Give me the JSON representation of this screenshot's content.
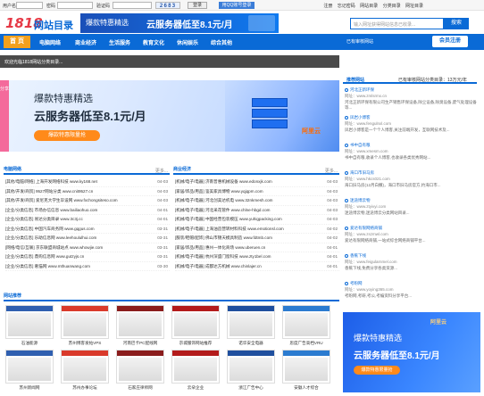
{
  "topbar": {
    "user_label": "用户名",
    "pass_label": "密码",
    "code_label": "验证码",
    "captcha": "2683",
    "login_btn": "登录",
    "qq_login": "用QQ账号登录",
    "links": [
      "注册",
      "忘记密码",
      "网站目录",
      "分类目录",
      "网址目录"
    ]
  },
  "header": {
    "logo_num": "1818",
    "logo_text": "网站目录",
    "banner_a": "爆款特惠精选",
    "banner_b": "云服务器低至8.1元/月",
    "search_placeholder": "输入网址获得网站信息已收录...",
    "search_btn": "搜索"
  },
  "nav": {
    "home": "首 页",
    "items": [
      "电脑网络",
      "商业经济",
      "生活服务",
      "教育文化",
      "休闲娱乐",
      "综合其他"
    ],
    "ad_text": "已有审核网站",
    "register": "会员注册"
  },
  "notice": "欢迎光临1818网站分类目录...",
  "left_ad_tag": "分享",
  "hero": {
    "line1": "爆款特惠精选",
    "line2": "云服务器低至8.1元/月",
    "button": "爆款特惠限量抢",
    "brand": "阿里云"
  },
  "news": {
    "left_title": "电脑网络",
    "right_title": "商业经济",
    "more": "更多...",
    "left_rows": [
      {
        "text": "[其他/电脑/网络] 上海开发网络科技 www.ky168.net",
        "date": "04-03"
      },
      {
        "text": "[其他/开发/商贸] 9527网站分类 www.cnit9527.cn",
        "date": "04-03"
      },
      {
        "text": "[其他/开发/商贸] 爱尼克大学生毕设网 www.fxchongsiteso.com",
        "date": "04-03"
      },
      {
        "text": "[企业/分类信息] 市场办信信息 www.bailiaohuo.com",
        "date": "04-01"
      },
      {
        "text": "[企业/分类信息] 易达分类目录 www.3c3j.cc",
        "date": "04-01"
      },
      {
        "text": "[企业/分类信息] 中国汽车商务网 www.gqgus.com",
        "date": "03-31"
      },
      {
        "text": "[企业/分类信息] 乐助信息网 www.leehoululhui.com",
        "date": "03-31"
      },
      {
        "text": "[网络/电信/互联] 京东联盟商城站点 www.whowjie.com",
        "date": "03-31"
      },
      {
        "text": "[企业/分类信息] 鼎购信息网 www.gutzyjs.cn",
        "date": "03-31"
      },
      {
        "text": "[企业/分类信息] 奢猫网 www.mthuanwang.com",
        "date": "03-30"
      }
    ],
    "right_rows": [
      {
        "text": "[机械/电子/电器] 济南普惠机械设备 www.edonxjk.com",
        "date": "04-03"
      },
      {
        "text": "[家居/饰品/用品] 鉴美家具博物 www.yqjqpm.com",
        "date": "04-03"
      },
      {
        "text": "[机械/电子/电器] 河北创美达机电 www.32nkmesh.com",
        "date": "04-03"
      },
      {
        "text": "[机械/电子/电器] 河北采花管件 www.chlne-hbgd.com",
        "date": "04-03"
      },
      {
        "text": "[机械/电子/电器] 中国经营包装模压 www.yuhigpacking.com",
        "date": "04-03"
      },
      {
        "text": "[机械/电子/电器] 上海油造营转材料科技 www.emotionsl.com",
        "date": "04-02"
      },
      {
        "text": "[服装/鞋帽/配饰] 佛山市锦天模具制造 www.fdtmb.com",
        "date": "04-02"
      },
      {
        "text": "[家居/饰品/用品] 惠州一体化商场 www.uberuen.cn",
        "date": "04-01"
      },
      {
        "text": "[机械/电子/电器] 杭州深盛门窗科技 www.zty1bel.com",
        "date": "04-01"
      },
      {
        "text": "[机械/电子/电器] 成都达方机械 www.chinlajer.cn",
        "date": "04-01"
      }
    ]
  },
  "sites": {
    "title": "网站推荐",
    "row1": [
      "石油能源",
      "苏州博客发帖VPS",
      "河南巴卡PC配线网",
      "京城服饰网站推荐",
      "诺华安全电器",
      "思度广告高档VRU"
    ],
    "row2": [
      "苏州新闻网",
      "苏州办事论坛",
      "石家庄律师网",
      "云朵企业",
      "浙江广告中心",
      "安徽人才综合"
    ]
  },
  "sidebar": {
    "title": "推荐网站",
    "subtitle": "已有审核网站分类目录：13万元/年",
    "items": [
      {
        "name": "河北正新环保",
        "url": "网址：www.zmlsrmx.cn",
        "desc": "河北正新环保有限公司生产销售环保设备,除尘设备,除臭设备,废气处理设备等..."
      },
      {
        "name": "凤岩小博客",
        "url": "网址：www.fengulnxl.com",
        "desc": "凤岩小博客是一个个人博客,关注前端开发，互联网技术及..."
      },
      {
        "name": "书中自有粮",
        "url": "网址：www.xmesm.com",
        "desc": "书中自有粮,收录个人博客,也收录各类优秀网站..."
      },
      {
        "name": "海口市旧马房",
        "url": "网址：www.hkcs021.com",
        "desc": "海口旧马房(12月白撒)，海口市旧马房官方,约海口市..."
      },
      {
        "name": "迷途博云物",
        "url": "网址：www.ztyivyi.com",
        "desc": "迷途博云物,迷途博云分类网站目录..."
      },
      {
        "name": "爱达有限网络商铺",
        "url": "网址：www.zszmwl.com",
        "desc": "爱达有限网络商铺,一站式综合网络商铺平台..."
      },
      {
        "name": "香蕉下线",
        "url": "网址：www.feigularnmel.com",
        "desc": "香蕉下线,免费分享各类资源..."
      },
      {
        "name": "考盼网",
        "url": "网址：www.yoying365.com",
        "desc": "考盼网,考研,考公,考编资料分享平台..."
      }
    ]
  },
  "side_ad": {
    "brand": "阿里云",
    "line1": "爆款特惠精选",
    "line2": "云服务器低至8.1元/月",
    "button": "爆款特惠限量抢"
  }
}
